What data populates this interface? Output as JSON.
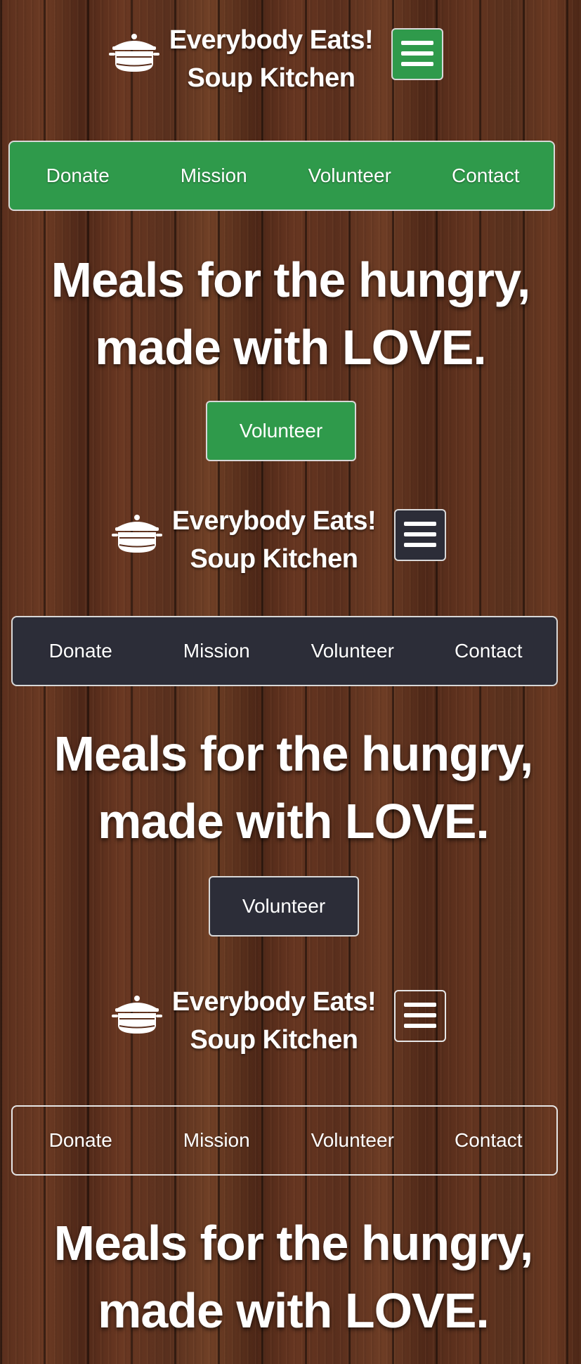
{
  "brand": {
    "line1": "Everybody Eats!",
    "line2": "Soup Kitchen",
    "logo_icon": "soup-pot-icon",
    "menu_icon": "hamburger-menu-icon"
  },
  "nav": {
    "items": [
      "Donate",
      "Mission",
      "Volunteer",
      "Contact"
    ]
  },
  "hero": {
    "line1": "Meals for the hungry,",
    "line2": "made with LOVE.",
    "cta_label": "Volunteer"
  },
  "themes": {
    "green": "#2f9a4b",
    "dark": "#2c2d38",
    "outline_border": "#e6e6e6",
    "text": "#ffffff"
  }
}
